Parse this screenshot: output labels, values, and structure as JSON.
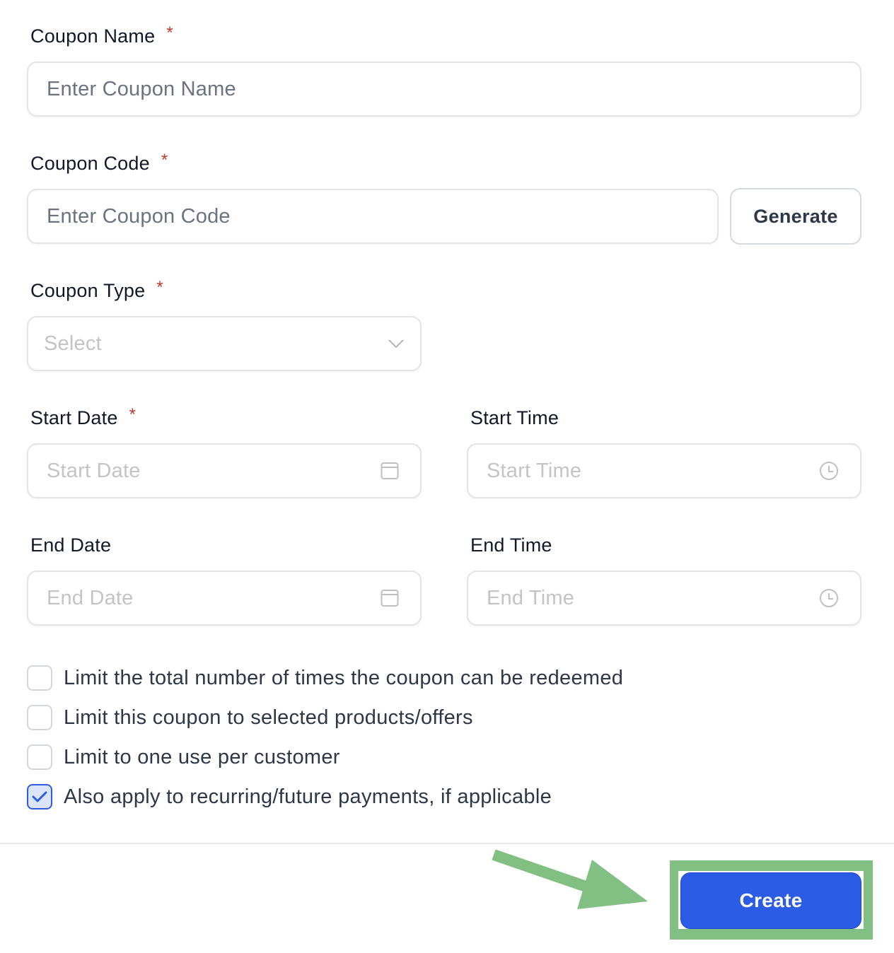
{
  "form": {
    "coupon_name": {
      "label": "Coupon Name",
      "required_mark": "*",
      "placeholder": "Enter Coupon Name",
      "value": ""
    },
    "coupon_code": {
      "label": "Coupon Code",
      "required_mark": "*",
      "placeholder": "Enter Coupon Code",
      "value": "",
      "generate_label": "Generate"
    },
    "coupon_type": {
      "label": "Coupon Type",
      "required_mark": "*",
      "selected": "Select"
    },
    "start_date": {
      "label": "Start Date",
      "required_mark": "*",
      "placeholder": "Start Date",
      "icon": "calendar-icon"
    },
    "start_time": {
      "label": "Start Time",
      "placeholder": "Start Time",
      "icon": "clock-icon"
    },
    "end_date": {
      "label": "End Date",
      "placeholder": "End Date",
      "icon": "calendar-icon"
    },
    "end_time": {
      "label": "End Time",
      "placeholder": "End Time",
      "icon": "clock-icon"
    },
    "options": [
      {
        "label": "Limit the total number of times the coupon can be redeemed",
        "checked": false
      },
      {
        "label": "Limit this coupon to selected products/offers",
        "checked": false
      },
      {
        "label": "Limit to one use per customer",
        "checked": false
      },
      {
        "label": "Also apply to recurring/future payments, if applicable",
        "checked": true
      }
    ]
  },
  "footer": {
    "create_label": "Create"
  },
  "annotation": {
    "color": "#82bf82",
    "target": "create-button"
  },
  "colors": {
    "primary": "#2c5ce6",
    "required": "#c0392b"
  }
}
